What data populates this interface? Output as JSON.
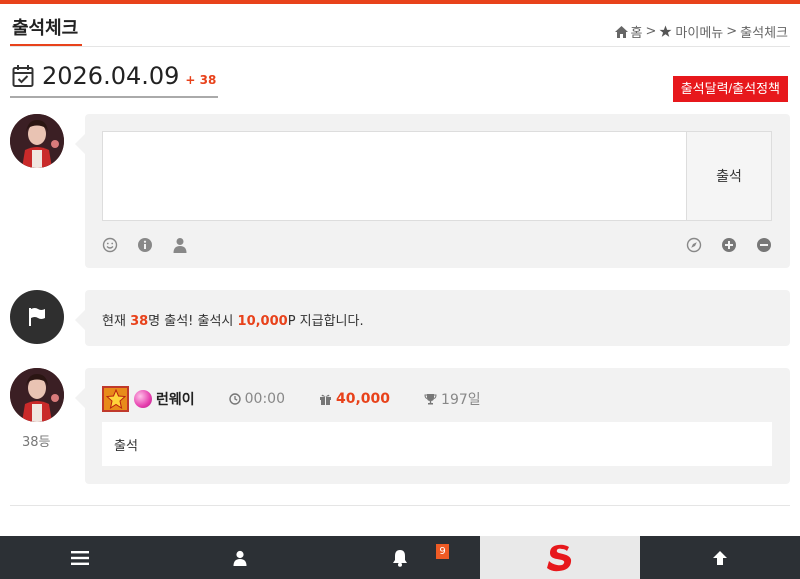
{
  "page": {
    "title": "출석체크"
  },
  "breadcrumb": {
    "home": "홈",
    "sep": ">",
    "my_menu": "마이메뉴",
    "current": "출석체크"
  },
  "attendance": {
    "date": "2026.04.09",
    "count_label": "+ 38",
    "calendar_button": "출석달력/출석정책"
  },
  "write_box": {
    "submit_label": "출석",
    "textarea_value": ""
  },
  "notice": {
    "prefix": "현재 ",
    "count": "38",
    "middle": "명 출석! 출석시 ",
    "points": "10,000",
    "suffix": "P 지급합니다."
  },
  "entry": {
    "rank": "38등",
    "user_name": "런웨이",
    "time": "00:00",
    "points": "40,000",
    "days": "197일",
    "message": "출석"
  },
  "bottom_nav": {
    "notification_count": "9"
  },
  "colors": {
    "accent": "#e8421b",
    "button_red": "#e7181c",
    "nav_bg": "#2c3035"
  }
}
